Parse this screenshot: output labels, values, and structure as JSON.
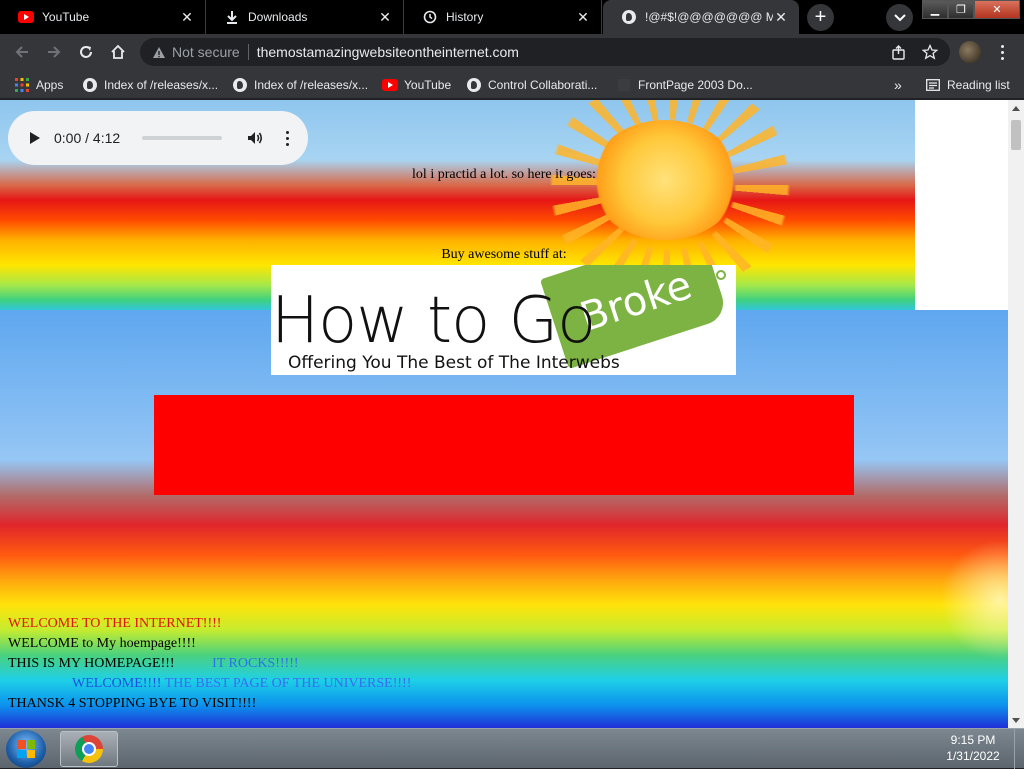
{
  "tabs": [
    {
      "title": "YouTube",
      "icon": "youtube-icon"
    },
    {
      "title": "Downloads",
      "icon": "download-icon"
    },
    {
      "title": "History",
      "icon": "history-icon"
    },
    {
      "title": "!@#$!@@@@@@@ MY",
      "icon": "globe-icon"
    }
  ],
  "toolbar": {
    "not_secure": "Not secure",
    "url": "themostamazingwebsiteontheinternet.com"
  },
  "bookmarks": {
    "apps": "Apps",
    "items": [
      {
        "label": "Index of /releases/x...",
        "icon": "globe-icon"
      },
      {
        "label": "Index of /releases/x...",
        "icon": "globe-icon"
      },
      {
        "label": "YouTube",
        "icon": "youtube-icon"
      },
      {
        "label": "Control Collaborati...",
        "icon": "globe-icon"
      },
      {
        "label": "FrontPage 2003 Do...",
        "icon": "page-icon"
      }
    ],
    "overflow": "»",
    "reading_list": "Reading list"
  },
  "page": {
    "audio_time": "0:00 / 4:12",
    "audio_progress": 0,
    "intro_text": "lol i practid a lot. so here it goes:",
    "buy_text": "Buy awesome stuff at:",
    "logo": {
      "main": "How to Go",
      "tag": "Broke",
      "tagline": "Offering You The Best of The Interwebs"
    },
    "lines": [
      {
        "text": "WELCOME TO THE INTERNET!!!!",
        "color": "#e0140e"
      },
      {
        "text": "WELCOME to My hoempage!!!!",
        "color": "#000000"
      },
      {
        "text": "THIS IS MY HOMEPAGE!!!",
        "color": "#000000"
      },
      {
        "text": "WELCOME!!!!",
        "color": "#1e4fe0"
      },
      {
        "text": "THANSK 4 STOPPING BYE TO VISIT!!!!",
        "color": "#000000"
      }
    ],
    "line3_extra": "IT ROCKS!!!!!",
    "line4_extra": "THE BEST PAGE OF THE UNIVERSE!!!!"
  },
  "colors": {
    "red_banner": "#ff0000",
    "logo_tag": "#7cb342"
  },
  "taskbar": {
    "time": "9:15 PM",
    "date": "1/31/2022"
  }
}
